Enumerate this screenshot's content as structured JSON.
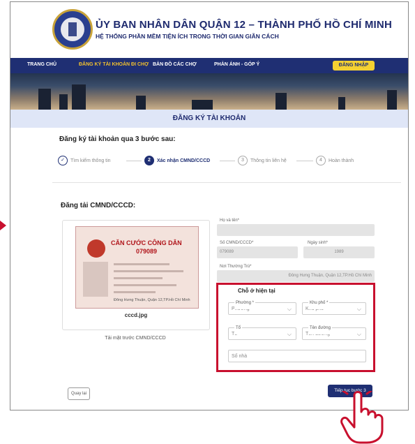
{
  "header": {
    "title": "ỦY BAN NHÂN DÂN QUẬN 12 – THÀNH PHỐ HỒ CHÍ MINH",
    "subtitle": "HỆ THỐNG PHẦN MỀM TIỆN ÍCH TRONG THỜI GIAN GIÃN CÁCH"
  },
  "nav": {
    "items": [
      "TRANG CHỦ",
      "ĐĂNG KÝ TÀI KHOẢN ĐI CHỢ",
      "BẢN ĐỒ CÁC CHỢ",
      "PHẢN ÁNH - GÓP Ý"
    ],
    "active_index": 1,
    "login_label": "ĐĂNG NHẬP"
  },
  "page": {
    "card_title": "ĐĂNG KÝ TÀI KHOẢN",
    "steps_title": "Đăng ký tài khoản qua 3 bước sau:",
    "steps": [
      {
        "num": "✓",
        "label": "Tìm kiếm thông tin",
        "state": "done"
      },
      {
        "num": "2",
        "label": "Xác nhận CMND/CCCD",
        "state": "current"
      },
      {
        "num": "3",
        "label": "Thông tin liên hệ",
        "state": "todo"
      },
      {
        "num": "4",
        "label": "Hoàn thành",
        "state": "todo"
      }
    ],
    "upload_title": "Đăng tải CMND/CCCD:"
  },
  "id_card": {
    "card_title": "CĂN CƯỚC CÔNG DÂN",
    "card_number": "079089",
    "address_line": "Đông Hưng Thuận, Quận 12,TP.Hồ Chí Minh",
    "file_name": "cccd.jpg",
    "caption": "Tải mặt trước CMND/CCCD"
  },
  "form": {
    "fullname_label": "Họ và tên*",
    "id_label": "Số CMND/CCCD*",
    "id_value": "079089",
    "dob_label": "Ngày sinh*",
    "dob_value": "1989",
    "residence_label": "Nơi Thường Trú*",
    "residence_value": "Đông Hưng Thuận, Quận 12,TP.Hồ Chí Minh",
    "current_address_title": "Chỗ ở hiện tại",
    "ward_label": "Phường *",
    "ward_value": "Phường",
    "quarter_label": "Khu phố *",
    "quarter_value": "Khu phố",
    "group_label": "Tổ",
    "group_value": "Tổ",
    "street_label": "Tên đường",
    "street_value": "Tên đường",
    "house_placeholder": "Số nhà"
  },
  "buttons": {
    "back_label": "Quay lại",
    "next_label": "Tiếp tục bước 3"
  },
  "colors": {
    "navy": "#1f2f73",
    "highlight": "#c8102e",
    "login_yellow": "#f5d131"
  }
}
